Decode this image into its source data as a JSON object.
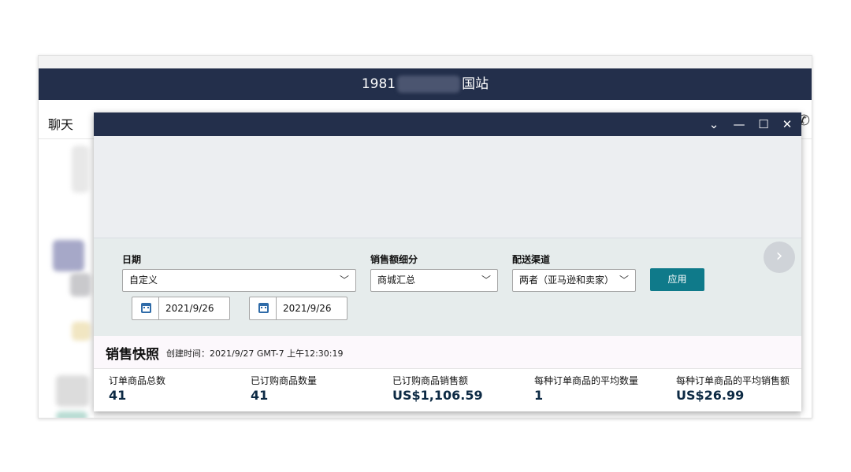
{
  "background_window": {
    "title_left": "1981",
    "title_right": "国站",
    "tab_chat": "聊天",
    "phone_icon": "phone-icon"
  },
  "dialog": {
    "window_controls": {
      "collapse_icon": "chevron-down-icon",
      "minimize_icon": "minimize-icon",
      "maximize_icon": "maximize-icon",
      "close_icon": "close-icon"
    },
    "filters": {
      "date_label": "日期",
      "date_value": "自定义",
      "breakdown_label": "销售额细分",
      "breakdown_value": "商城汇总",
      "channel_label": "配送渠道",
      "channel_value": "两者（亚马逊和卖家）",
      "apply_label": "应用",
      "start_date": "2021/9/26",
      "end_date": "2021/9/26"
    },
    "snapshot": {
      "title": "销售快照",
      "created_time": "创建时间：2021/9/27 GMT-7 上午12:30:19",
      "metrics": [
        {
          "label": "订单商品总数",
          "value": "41"
        },
        {
          "label": "已订购商品数量",
          "value": "41"
        },
        {
          "label": "已订购商品销售额",
          "value": "US$1,106.59"
        },
        {
          "label": "每种订单商品的平均数量",
          "value": "1"
        },
        {
          "label": "每种订单商品的平均销售额",
          "value": "US$26.99"
        }
      ]
    }
  }
}
